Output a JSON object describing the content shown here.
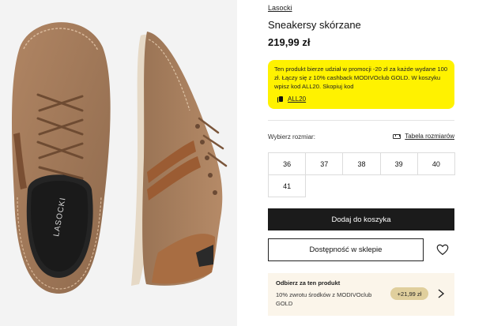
{
  "product": {
    "brand": "Lasocki",
    "title": "Sneakersy skórzane",
    "price": "219,99 zł",
    "insole_brand": "LASOCKI"
  },
  "promo": {
    "text": "Ten produkt bierze udział w promocji -20 zł za każde wydane 100 zł. Łączy się z 10% cashback MODIVOclub GOLD. W koszyku wpisz kod ALL20. Skopiuj kod",
    "code": "ALL20",
    "background": "#fff200"
  },
  "size_selector": {
    "label": "Wybierz rozmiar:",
    "size_table_label": "Tabela rozmiarów",
    "sizes": [
      "36",
      "37",
      "38",
      "39",
      "40",
      "41"
    ]
  },
  "actions": {
    "add_to_cart": "Dodaj do koszyka",
    "store_availability": "Dostępność w sklepie"
  },
  "reward": {
    "title": "Odbierz za ten produkt",
    "description": "10% zwrotu środków z MODIVOclub GOLD",
    "badge": "+21,99 zł"
  },
  "icons": {
    "copy": "copy-icon",
    "size_table": "ruler-icon",
    "wishlist": "heart-icon",
    "next": "chevron-right-icon"
  },
  "colors": {
    "primary_button": "#1b1b1b",
    "promo_background": "#fff200",
    "reward_background": "#fbf5ea",
    "reward_badge": "#e0cf9d",
    "shoe_leather": "#a37a5c"
  }
}
